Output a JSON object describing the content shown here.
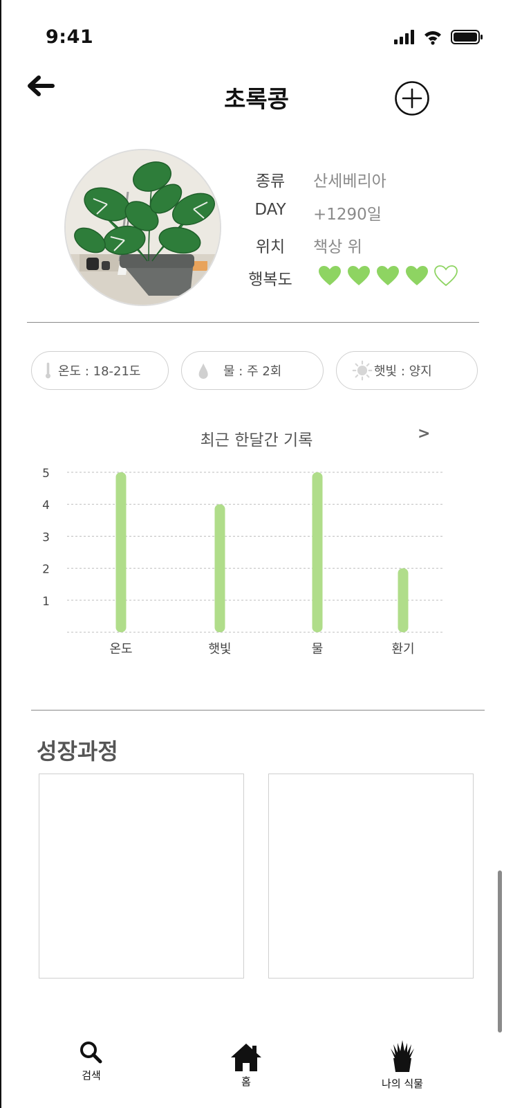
{
  "status_bar": {
    "time": "9:41"
  },
  "header": {
    "title": "초록콩"
  },
  "profile": {
    "rows": [
      {
        "label": "종류",
        "value": "산세베리아"
      },
      {
        "label": "DAY",
        "value": "+1290일"
      },
      {
        "label": "위치",
        "value": "책상 위"
      }
    ],
    "happiness_label": "행복도",
    "happiness": {
      "filled": 4,
      "total": 5
    },
    "heart_color": "#8ed462"
  },
  "chips": {
    "temperature": "온도 : 18-21도",
    "water": "물 : 주 2회",
    "sunlight": "햇빛 :  양지"
  },
  "chart_section": {
    "title": "최근 한달간 기록",
    "more": ">"
  },
  "chart_data": {
    "type": "bar",
    "categories": [
      "온도",
      "햇빛",
      "물",
      "환기"
    ],
    "values": [
      5,
      4,
      5,
      2
    ],
    "ylim": [
      0,
      5
    ],
    "yticks": [
      1,
      2,
      3,
      4,
      5
    ],
    "grid": true,
    "color": "#b0dd8a"
  },
  "growth": {
    "title": "성장과정"
  },
  "tabbar": [
    {
      "label": "검색",
      "icon": "search-icon"
    },
    {
      "label": "홈",
      "icon": "home-icon"
    },
    {
      "label": "나의 식물",
      "icon": "plant-icon"
    }
  ]
}
